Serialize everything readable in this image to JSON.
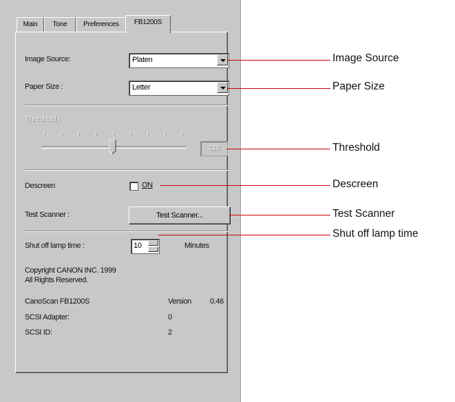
{
  "tabs": [
    "Main",
    "Tone",
    "Preferences",
    "FB1200S"
  ],
  "image_source": {
    "label": "Image Source:",
    "value": "Platen"
  },
  "paper_size": {
    "label": "Paper Size :",
    "value": "Letter"
  },
  "threshold": {
    "label": "Threshold :",
    "value": "128"
  },
  "descreen": {
    "label": "Descreen",
    "checkbox_label": "ON",
    "checked": false
  },
  "test_scanner": {
    "label": "Test Scanner :",
    "button_label": "Test Scanner..."
  },
  "lamp": {
    "label": "Shut off lamp time :",
    "value": "10",
    "units": "Minutes"
  },
  "copyright": [
    "Copyright CANON INC. 1999",
    "All Rights Reserved."
  ],
  "info": {
    "model": "CanoScan FB1200S",
    "version_label": "Version",
    "version": "0.46",
    "adapter_label": "SCSI Adapter:",
    "adapter": "0",
    "id_label": "SCSI ID:",
    "id": "2"
  },
  "callouts": {
    "image_source": "Image Source",
    "paper_size": "Paper Size",
    "threshold": "Threshold",
    "descreen": "Descreen",
    "test_scanner": "Test Scanner",
    "lamp": "Shut off lamp time"
  },
  "colors": {
    "callout_line": "#cc0000",
    "dialog_bg": "#c8c8c8"
  }
}
